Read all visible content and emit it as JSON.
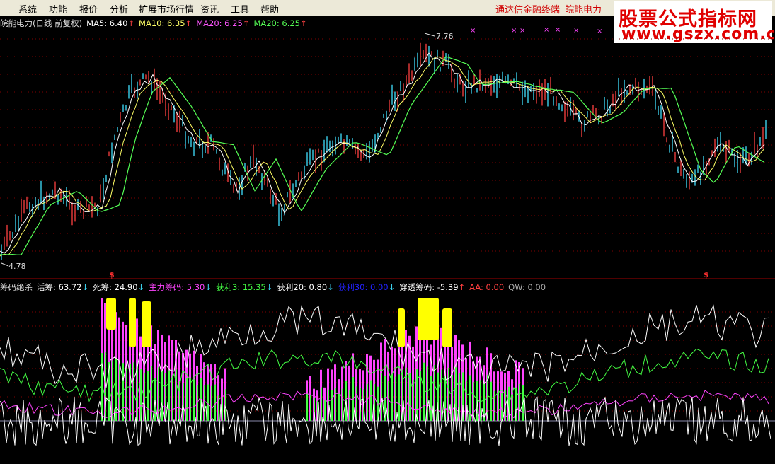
{
  "menu": [
    "系统",
    "功能",
    "报价",
    "分析",
    "扩展市场行情",
    "资讯",
    "工具",
    "帮助"
  ],
  "menu_right": [
    "通达信金融终端",
    "皖能电力"
  ],
  "watermark": {
    "line1": "股票公式指标网",
    "line2": "www.gszx.com.cn"
  },
  "price_panel": {
    "title": "皖能电力(日线 前复权)",
    "ma": [
      {
        "label": "MA5: 6.40",
        "color": "#ffffff",
        "arrow": "↑"
      },
      {
        "label": "MA10: 6.35",
        "color": "#ffff66",
        "arrow": "↑"
      },
      {
        "label": "MA20: 6.25",
        "color": "#ff55ff",
        "arrow": "↑"
      },
      {
        "label": "MA20: 6.25",
        "color": "#55ff55",
        "arrow": "↑"
      }
    ],
    "high_label": "7.76",
    "low_label": "4.78"
  },
  "indicator_panel": {
    "title": "筹码绝杀",
    "items": [
      {
        "label": "活筹: 63.72",
        "color": "#ffffff",
        "arrow": "↓"
      },
      {
        "label": "死筹: 24.90",
        "color": "#ffffff",
        "arrow": "↓"
      },
      {
        "label": "主力筹码: 5.30",
        "color": "#ff44ff",
        "arrow": "↓"
      },
      {
        "label": "获利3: 15.35",
        "color": "#44ff44",
        "arrow": "↓"
      },
      {
        "label": "获利20: 0.80",
        "color": "#ffffff",
        "arrow": "↓"
      },
      {
        "label": "获利30: 0.00",
        "color": "#2222ff",
        "arrow": "↓"
      },
      {
        "label": "穿透筹码: -5.39",
        "color": "#ffffff",
        "arrow": "↑"
      },
      {
        "label": "AA: 0.00",
        "color": "#ff4040",
        "arrow": ""
      },
      {
        "label": "QW: 0.00",
        "color": "#aaaaaa",
        "arrow": ""
      }
    ]
  },
  "colors": {
    "up": "#ff4040",
    "down": "#40e0ff",
    "grid": "#800000",
    "ma5": "#ffffff",
    "ma10": "#ffff66",
    "ma_long": "#55ff55",
    "main": "#ff44ff",
    "profit": "#44ff44",
    "highlight": "#ffff00"
  }
}
